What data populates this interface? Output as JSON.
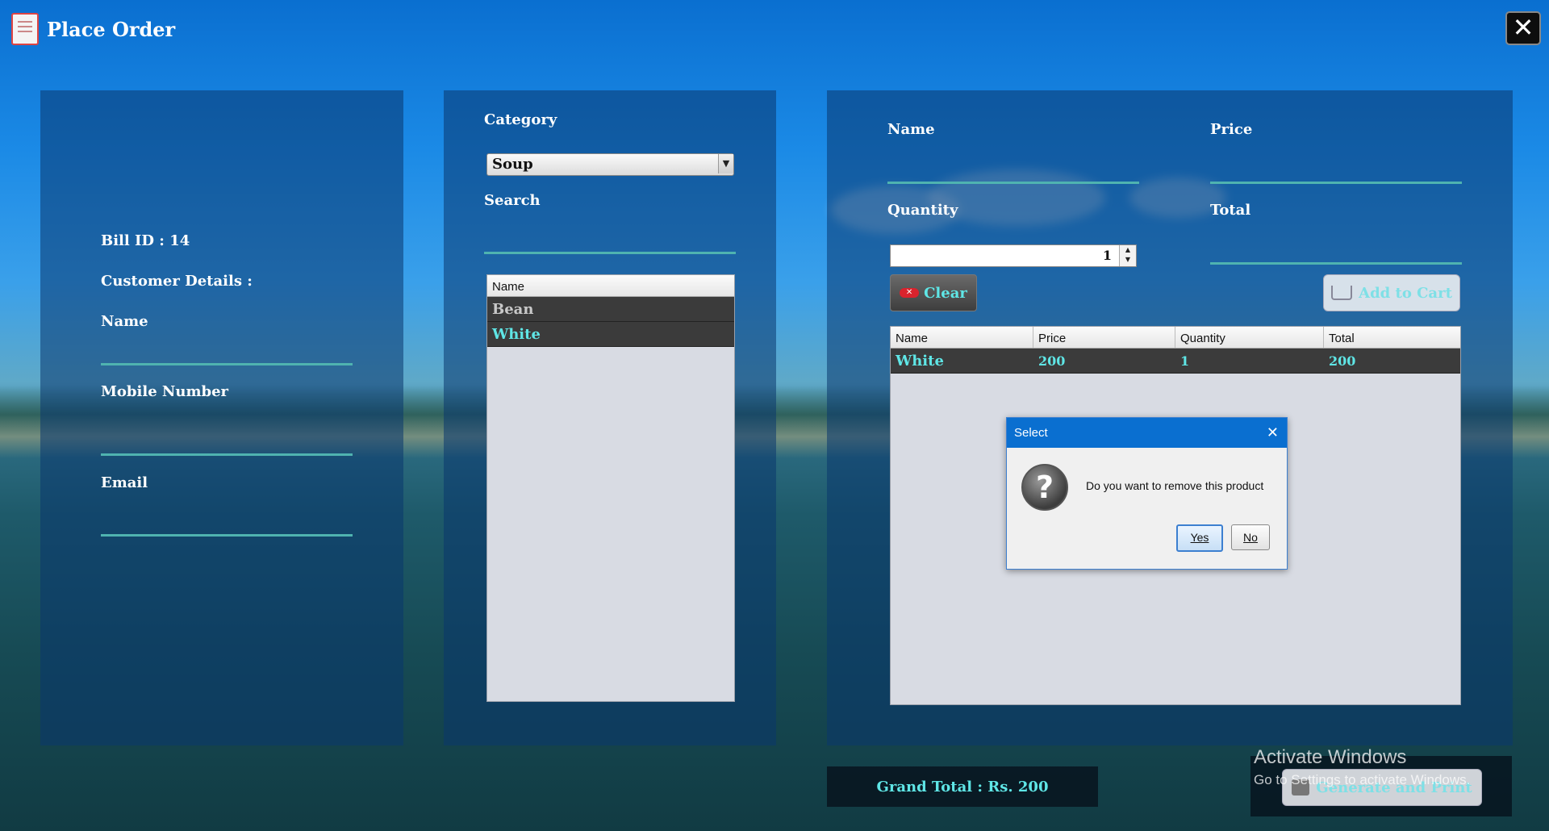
{
  "window": {
    "title": "Place Order",
    "close_label": "✕"
  },
  "customer": {
    "bill_id_label": "Bill ID : 14",
    "details_label": "Customer Details :",
    "name_label": "Name",
    "mobile_label": "Mobile Number",
    "email_label": "Email",
    "name_value": "",
    "mobile_value": "",
    "email_value": ""
  },
  "products": {
    "category_label": "Category",
    "category_selected": "Soup",
    "search_label": "Search",
    "search_value": "",
    "table_header": "Name",
    "rows": [
      "Bean",
      "White"
    ]
  },
  "order": {
    "name_label": "Name",
    "price_label": "Price",
    "quantity_label": "Quantity",
    "total_label": "Total",
    "quantity_value": "1",
    "clear_label": "Clear",
    "add_to_cart_label": "Add to Cart",
    "cart_headers": [
      "Name",
      "Price",
      "Quantity",
      "Total"
    ],
    "cart_rows": [
      {
        "name": "White",
        "price": "200",
        "quantity": "1",
        "total": "200"
      }
    ],
    "grand_total": "Grand Total : Rs. 200",
    "print_label": "Generate and Print"
  },
  "dialog": {
    "title": "Select",
    "message": "Do you want to remove this product",
    "yes_label": "Yes",
    "no_label": "No"
  },
  "watermark": {
    "line1": "Activate Windows",
    "line2": "Go to Settings to activate Windows."
  },
  "colors": {
    "accent_teal": "#5fe6e6",
    "underline": "#4fb3b0",
    "dialog_blue": "#0a6fd0"
  }
}
